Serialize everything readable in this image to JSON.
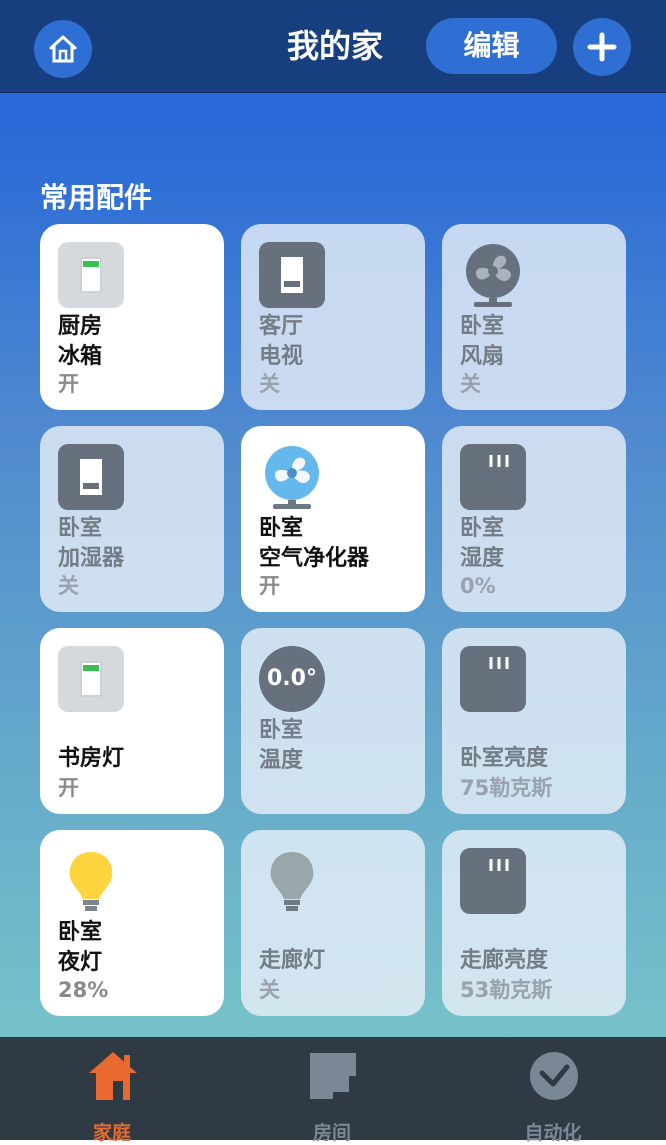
{
  "header": {
    "title": "我的家",
    "edit_label": "编辑"
  },
  "section": {
    "title": "常用配件"
  },
  "tiles": [
    {
      "name": "厨房\n冰箱",
      "status": "开"
    },
    {
      "name": "客厅\n电视",
      "status": "关"
    },
    {
      "name": "卧室\n风扇",
      "status": "关"
    },
    {
      "name": "卧室\n加湿器",
      "status": "关"
    },
    {
      "name": "卧室\n空气净化器",
      "status": "开"
    },
    {
      "name": "卧室\n湿度",
      "status": "0%"
    },
    {
      "name": "书房灯",
      "status": "开"
    },
    {
      "name": "卧室\n温度",
      "status": "0.0°"
    },
    {
      "name": "卧室亮度",
      "status": "75勒克斯"
    },
    {
      "name": "卧室\n夜灯",
      "status": "28%"
    },
    {
      "name": "走廊灯",
      "status": "关"
    },
    {
      "name": "走廊亮度",
      "status": "53勒克斯"
    }
  ],
  "tabs": [
    {
      "label": "家庭",
      "icon": "home-icon",
      "active": true
    },
    {
      "label": "房间",
      "icon": "rooms-icon",
      "active": false
    },
    {
      "label": "自动化",
      "icon": "automation-icon",
      "active": false
    }
  ],
  "colors": {
    "header": "#173f7f",
    "accent": "#2f6fd3",
    "active_tab": "#e86a31"
  }
}
